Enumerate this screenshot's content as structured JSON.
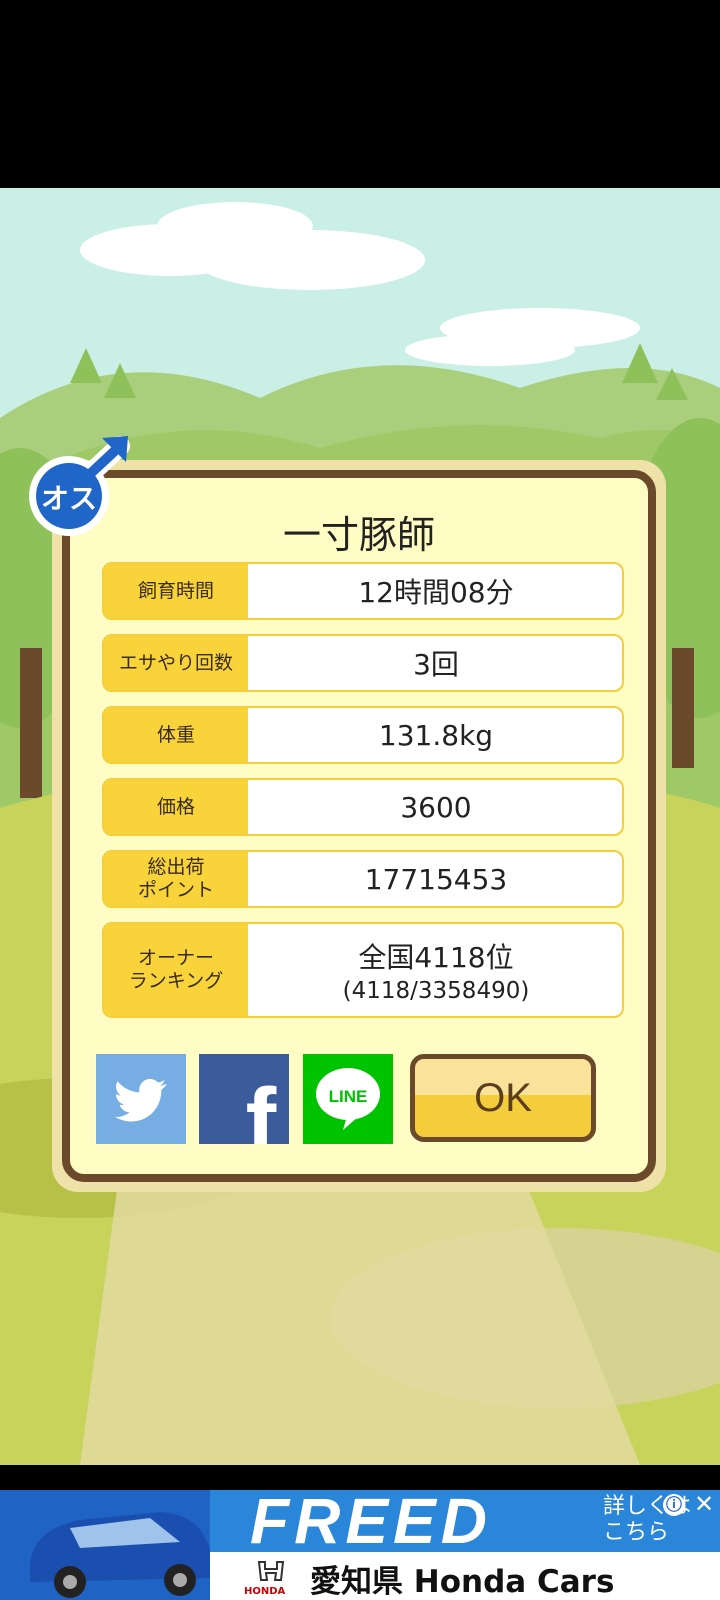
{
  "game": {
    "gender_badge": "オス",
    "dialog": {
      "title": "一寸豚師",
      "rows": [
        {
          "label": "飼育時間",
          "value": "12時間08分"
        },
        {
          "label": "エサやり回数",
          "value": "3回"
        },
        {
          "label": "体重",
          "value": "131.8kg"
        },
        {
          "label": "価格",
          "value": "3600"
        },
        {
          "label": "総出荷\nポイント",
          "value": "17715453"
        },
        {
          "label": "オーナー\nランキング",
          "value": "全国4118位",
          "sub": "(4118/3358490)"
        }
      ],
      "social": {
        "line_label": "LINE",
        "facebook_glyph": "f"
      },
      "ok_label": "OK"
    }
  },
  "ad": {
    "title": "FREED",
    "cta": "詳しくは\nこちら",
    "dealer": "愛知県 Honda Cars",
    "brand": "HONDA",
    "info_icon": "ⓘ",
    "close_icon": "✕"
  },
  "colors": {
    "dialog_border": "#6b4a2b",
    "dialog_bg": "#fffcc4",
    "label_bg": "#f8d43a",
    "twitter": "#76aee4",
    "facebook": "#3b5b9a",
    "line": "#00c300",
    "ad_bg": "#1f63c4"
  }
}
